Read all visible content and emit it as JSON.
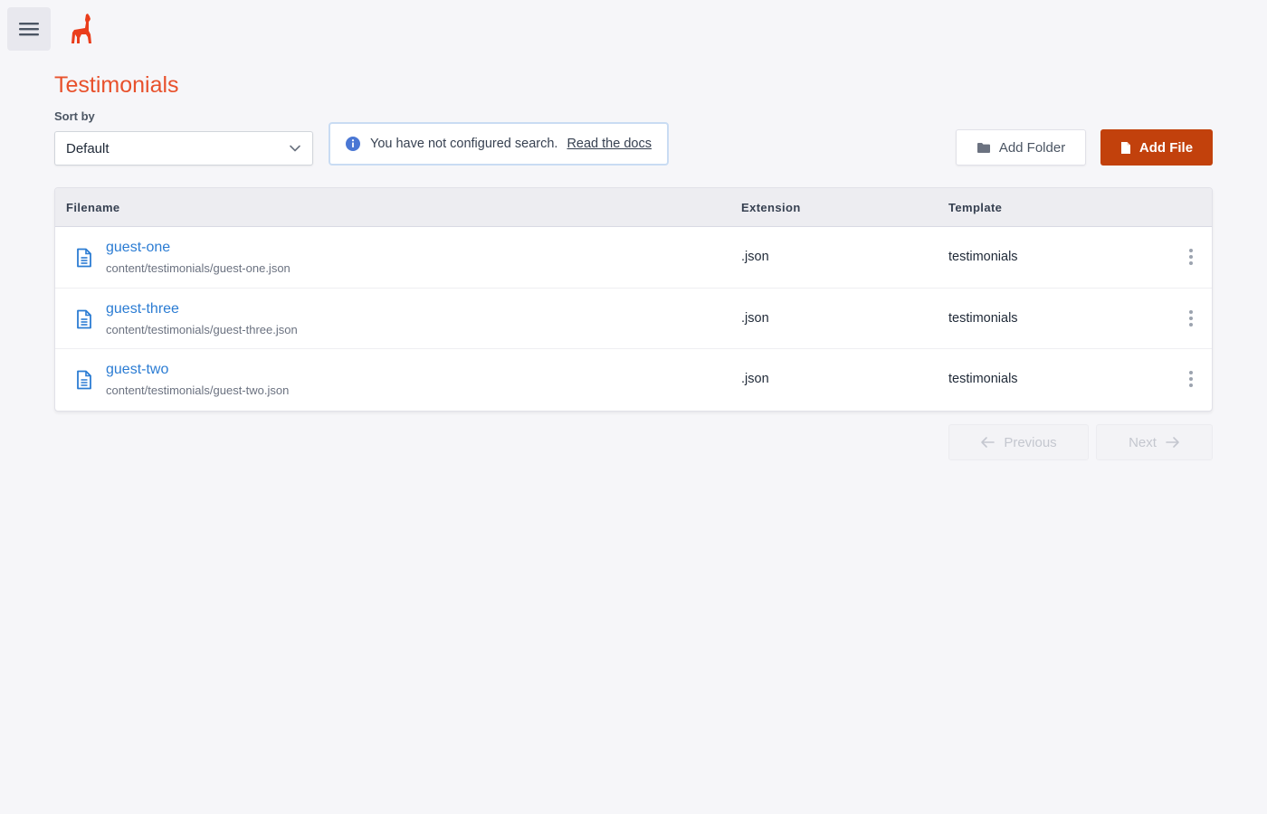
{
  "header": {
    "menu_icon": "hamburger-icon",
    "logo_icon": "llama-logo-icon"
  },
  "page": {
    "title": "Testimonials"
  },
  "sort": {
    "label": "Sort by",
    "selected": "Default"
  },
  "search_notice": {
    "icon": "info-icon",
    "text": "You have not configured search.",
    "link": "Read the docs"
  },
  "actions": {
    "add_folder": "Add Folder",
    "add_file": "Add File"
  },
  "table": {
    "columns": [
      "Filename",
      "Extension",
      "Template"
    ],
    "rows": [
      {
        "name": "guest-one",
        "path": "content/testimonials/guest-one.json",
        "extension": ".json",
        "template": "testimonials"
      },
      {
        "name": "guest-three",
        "path": "content/testimonials/guest-three.json",
        "extension": ".json",
        "template": "testimonials"
      },
      {
        "name": "guest-two",
        "path": "content/testimonials/guest-two.json",
        "extension": ".json",
        "template": "testimonials"
      }
    ]
  },
  "pagination": {
    "previous": "Previous",
    "next": "Next"
  },
  "colors": {
    "brand": "#e8512c",
    "primary_button": "#c2410c",
    "link": "#2b7cd3"
  }
}
